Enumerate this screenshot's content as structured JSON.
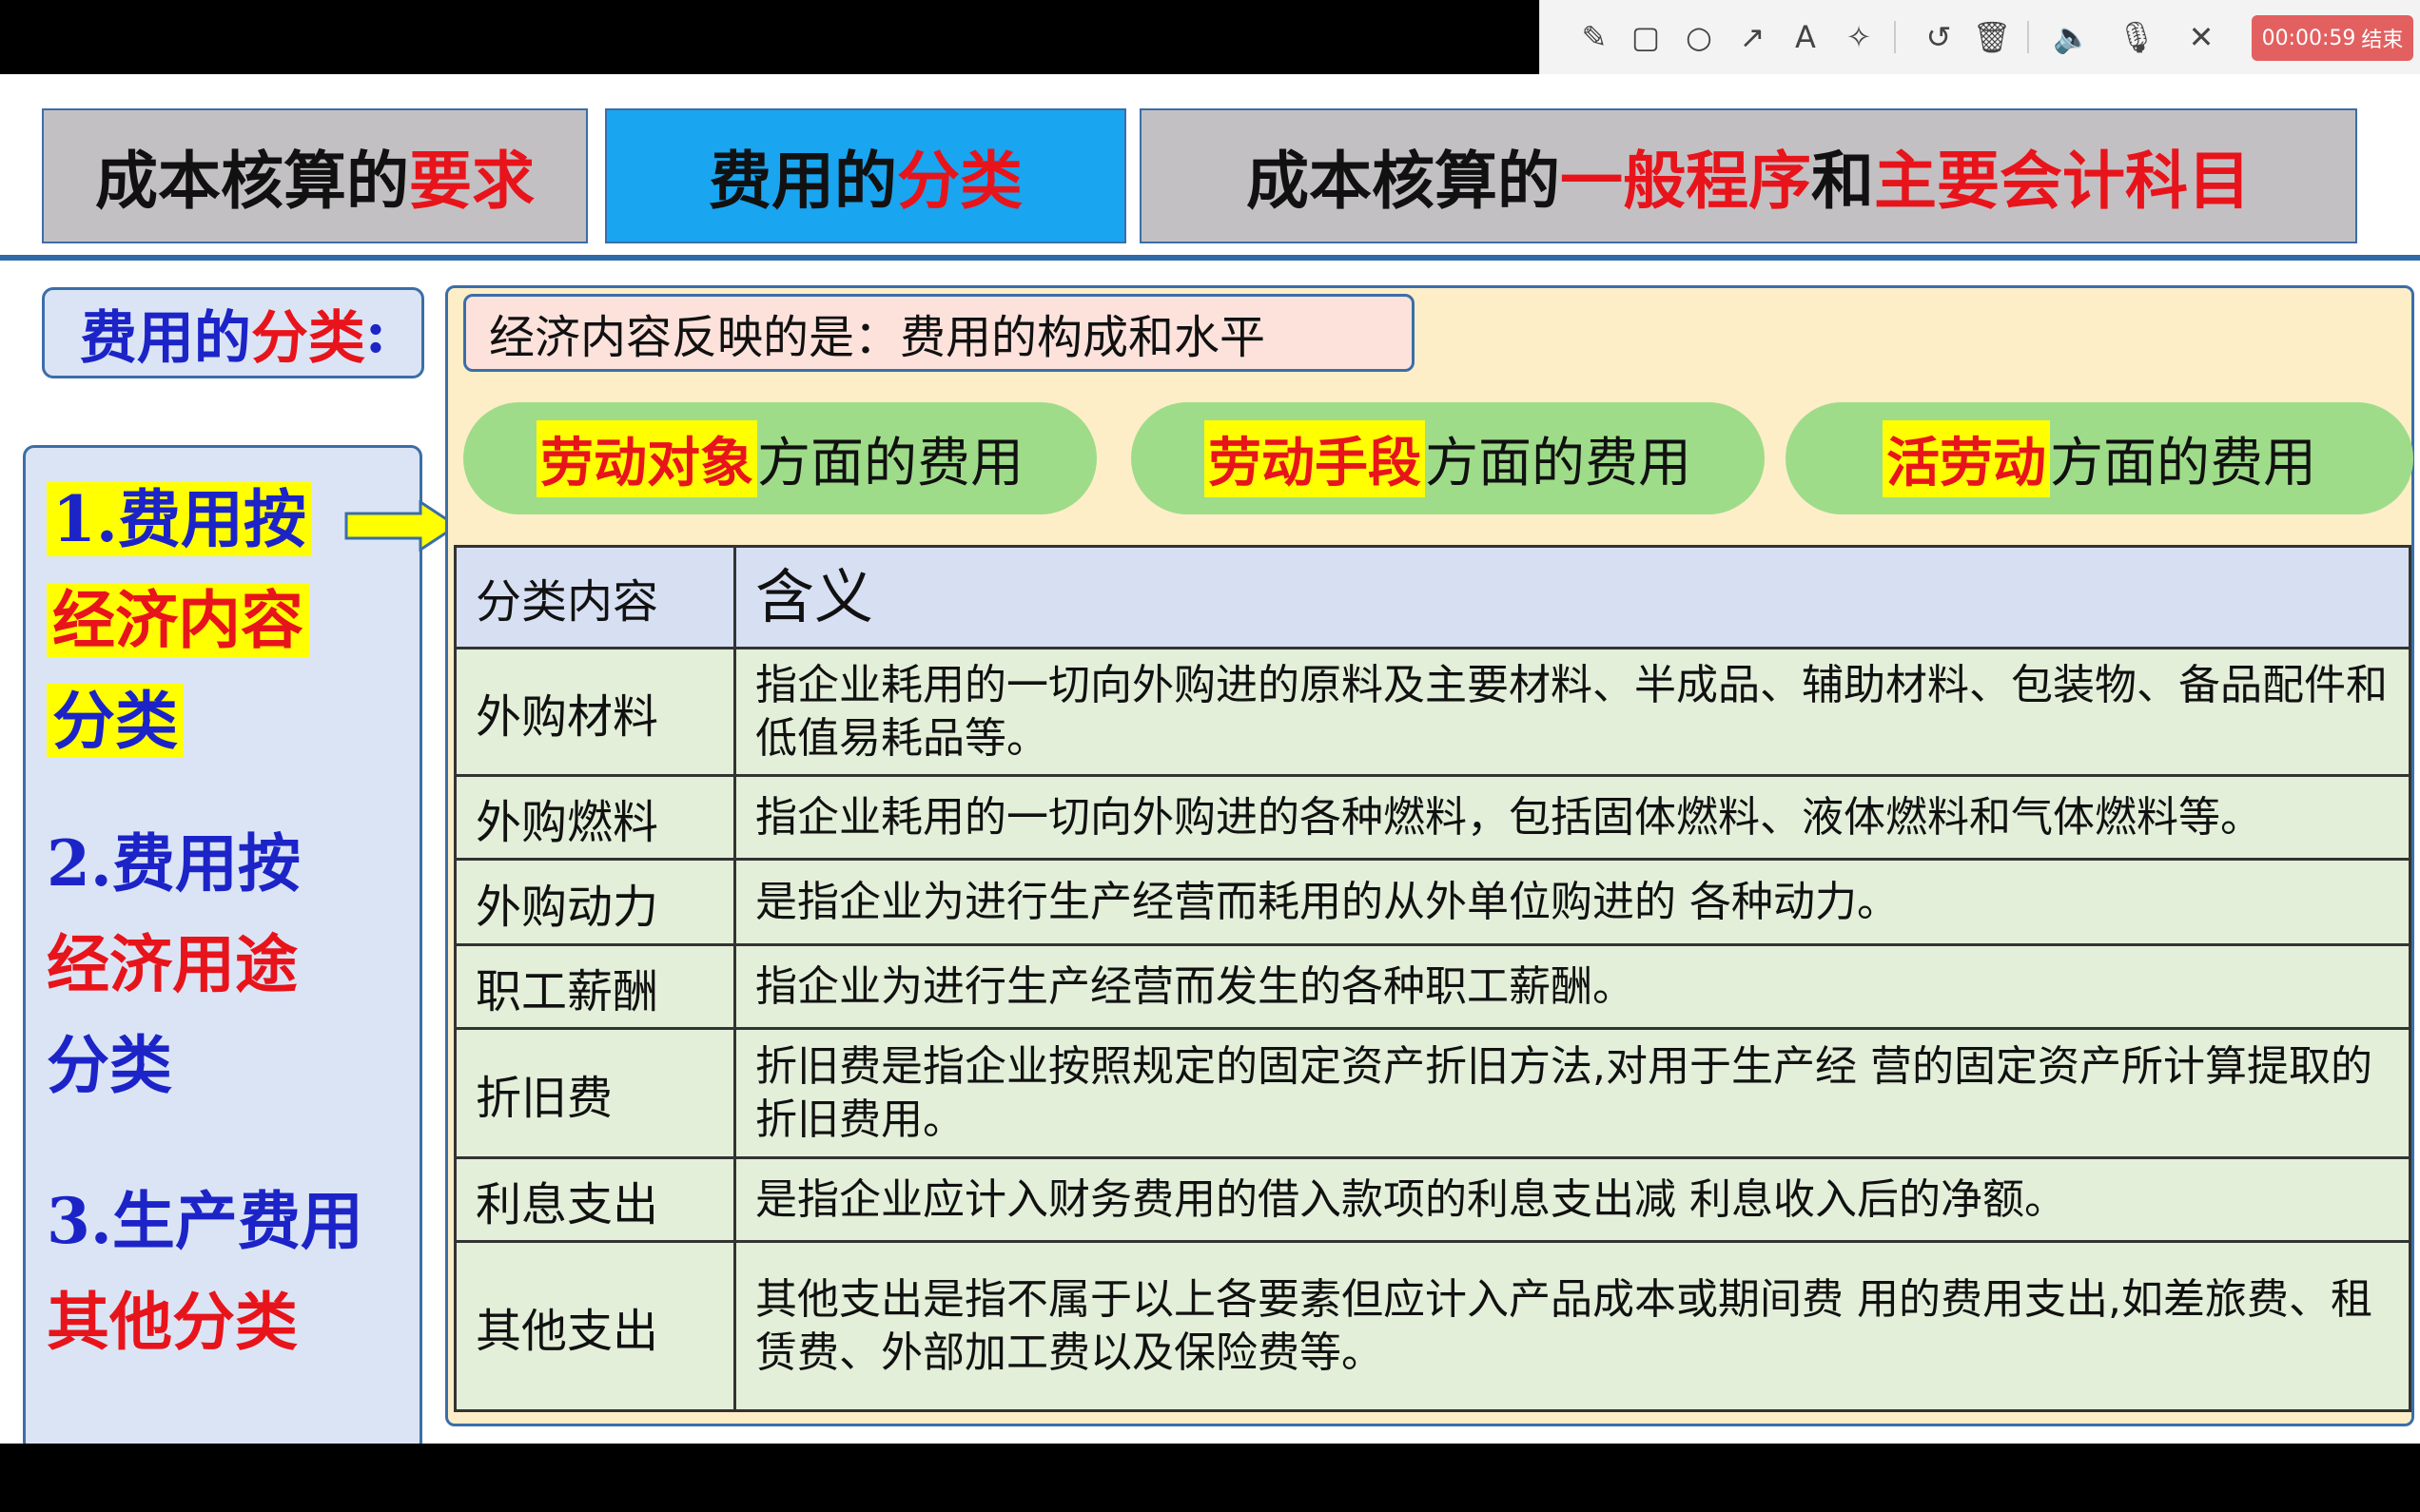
{
  "toolbar": {
    "icons": [
      "pencil-icon",
      "rectangle-icon",
      "circle-icon",
      "arrow-icon",
      "text-icon",
      "magic-wand-icon",
      "undo-icon",
      "trash-icon",
      "speaker-icon",
      "microphone-icon",
      "close-icon"
    ],
    "timer": "00:00:59",
    "end_label": "结束"
  },
  "tabs": [
    {
      "a": "成本核算的",
      "b": "要求",
      "c": "",
      "d": ""
    },
    {
      "a": "费用的",
      "b": "分类",
      "c": "",
      "d": ""
    },
    {
      "a": "成本核算的",
      "b": "一般程序",
      "c": "和",
      "d": "主要会计科目"
    }
  ],
  "label": {
    "a": "费用的",
    "b": "分类",
    "c": ":"
  },
  "left": {
    "item1": {
      "l1": "1.费用按",
      "l2": "经济内容",
      "l3": "分类"
    },
    "item2": {
      "l1": "2.费用按",
      "l2": "经济用途",
      "l3": "分类"
    },
    "item3": {
      "l1": "3.生产费用",
      "l2": "其他分类"
    }
  },
  "reflect": "经济内容反映的是：费用的构成和水平",
  "pills": [
    {
      "hl": "劳动对象",
      "rest": "方面的费用"
    },
    {
      "hl": "劳动手段",
      "rest": "方面的费用"
    },
    {
      "hl": "活劳动",
      "rest": "方面的费用"
    }
  ],
  "table": {
    "headers": [
      "分类内容",
      "含义"
    ],
    "rows": [
      [
        "外购材料",
        "指企业耗用的一切向外购进的原料及主要材料、半成品、辅助材料、包装物、备品配件和低值易耗品等。"
      ],
      [
        "外购燃料",
        "指企业耗用的一切向外购进的各种燃料，包括固体燃料、液体燃料和气体燃料等。"
      ],
      [
        "外购动力",
        "是指企业为进行生产经营而耗用的从外单位购进的 各种动力。"
      ],
      [
        "职工薪酬",
        "指企业为进行生产经营而发生的各种职工薪酬。"
      ],
      [
        "折旧费",
        "折旧费是指企业按照规定的固定资产折旧方法,对用于生产经 营的固定资产所计算提取的折旧费用。"
      ],
      [
        "利息支出",
        "是指企业应计入财务费用的借入款项的利息支出减 利息收入后的净额。"
      ],
      [
        "其他支出",
        "其他支出是指不属于以上各要素但应计入产品成本或期间费 用的费用支出,如差旅费、租赁费、外部加工费以及保险费等。"
      ]
    ]
  }
}
